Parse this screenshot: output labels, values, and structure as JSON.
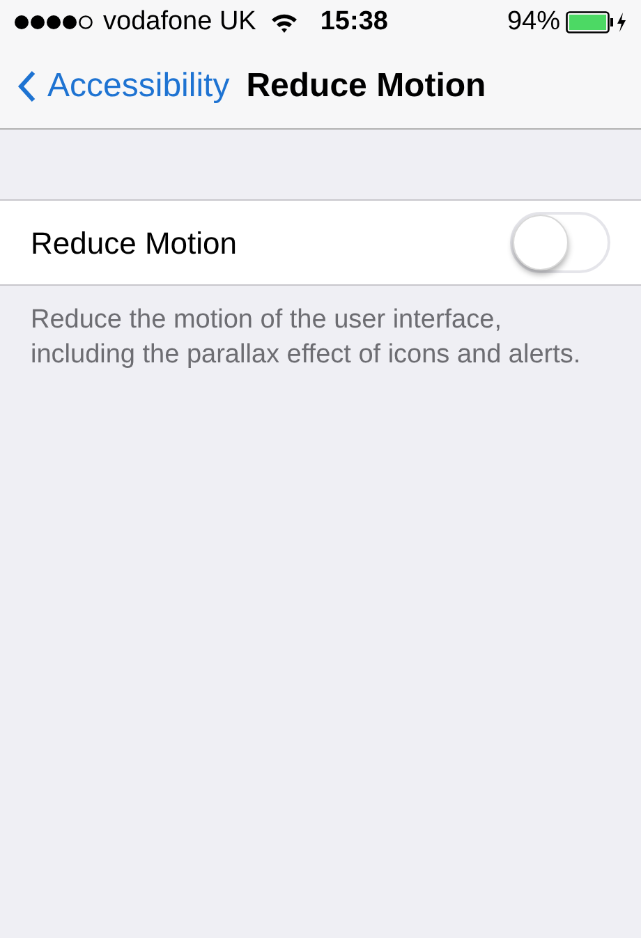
{
  "status_bar": {
    "carrier": "vodafone UK",
    "time": "15:38",
    "battery": "94%"
  },
  "nav_bar": {
    "back": "Accessibility",
    "title": "Reduce Motion"
  },
  "settings": [
    {
      "label": "Reduce Motion",
      "on": false
    }
  ],
  "footer": "Reduce the motion of the user interface, including the parallax effect of icons and alerts."
}
